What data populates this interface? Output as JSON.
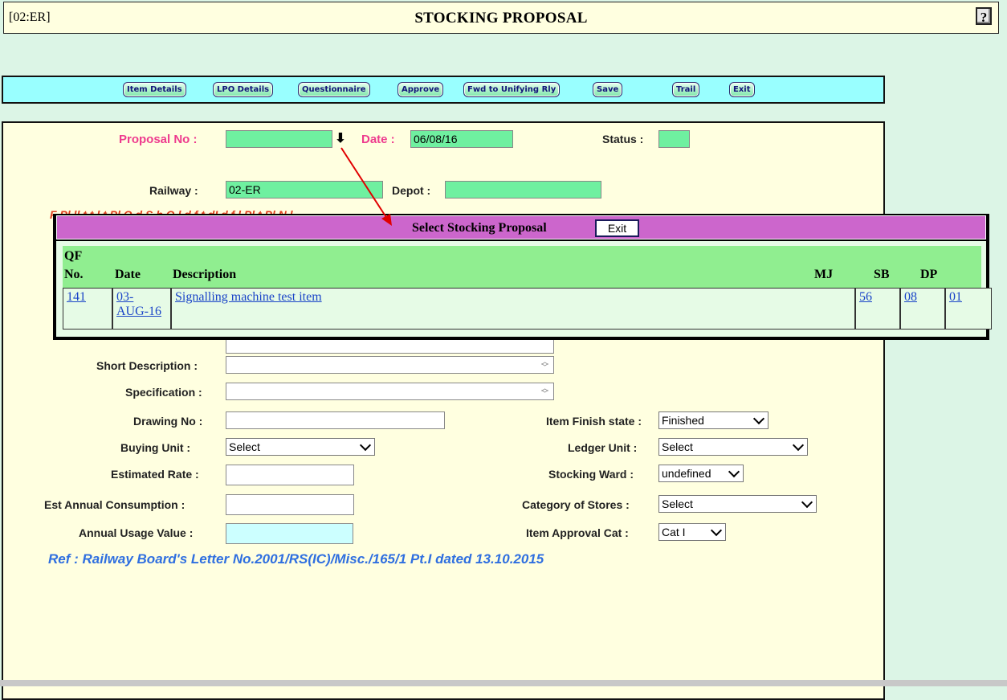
{
  "header": {
    "code": "[02:ER]",
    "title": "STOCKING PROPOSAL",
    "help": "?"
  },
  "toolbar": {
    "buttons": [
      "Item Details",
      "LPO Details",
      "Questionnaire",
      "Approve",
      "Fwd to Unifying Rly",
      "Save",
      "Trail",
      "Exit"
    ]
  },
  "form": {
    "proposal_no_label": "Proposal No :",
    "proposal_no_value": "",
    "date_label": "Date :",
    "date_value": "06/08/16",
    "status_label": "Status :",
    "status_value": "",
    "railway_label": "Railway :",
    "railway_value": "02-ER",
    "depot_label": "Depot :",
    "depot_value": "",
    "red_note_visible": "F          Pl  ll t   t  l  t Pl  O   d S b O          l  d f  t  dI         d f  l     Pl   t  Pl N   l",
    "short_desc_label": "Short Description :",
    "specification_label": "Specification :",
    "drawing_no_label": "Drawing No :",
    "buying_unit_label": "Buying Unit :",
    "buying_unit_value": "Select",
    "estimated_rate_label": "Estimated Rate :",
    "est_annual_label": "Est Annual Consumption :",
    "annual_usage_label": "Annual Usage Value :",
    "item_finish_label": "Item Finish state :",
    "item_finish_value": "Finished",
    "ledger_unit_label": "Ledger Unit :",
    "ledger_unit_value": "Select",
    "stocking_ward_label": "Stocking Ward :",
    "stocking_ward_value": "undefined",
    "category_label": "Category of Stores :",
    "category_value": "Select",
    "approval_cat_label": "Item Approval Cat :",
    "approval_cat_value": "Cat I",
    "ref": "Ref : Railway Board's Letter No.2001/RS(IC)/Misc./165/1 Pt.I dated 13.10.2015"
  },
  "popup": {
    "title": "Select Stocking Proposal",
    "exit": "Exit",
    "columns": {
      "qf": "QF",
      "no": "No.",
      "date": "Date",
      "desc": "Description",
      "mj": "MJ",
      "sb": "SB",
      "dp": "DP"
    },
    "rows": [
      {
        "qf_no": "141",
        "date_1": "03-",
        "date_2": "AUG-16",
        "description": "Signalling machine test item",
        "mj": "56",
        "sb": "08",
        "dp": "01"
      }
    ]
  },
  "colors": {
    "accent_pink": "#ee3b8e",
    "field_green": "#6ff0a0",
    "toolbar_cyan": "#99ffff",
    "popup_title": "#cc66cc",
    "ref_blue": "#2f6fe0",
    "arrow_red": "#e00000"
  },
  "icons": {
    "dropdown_arrow": "down-arrow-icon",
    "help": "help-icon"
  }
}
